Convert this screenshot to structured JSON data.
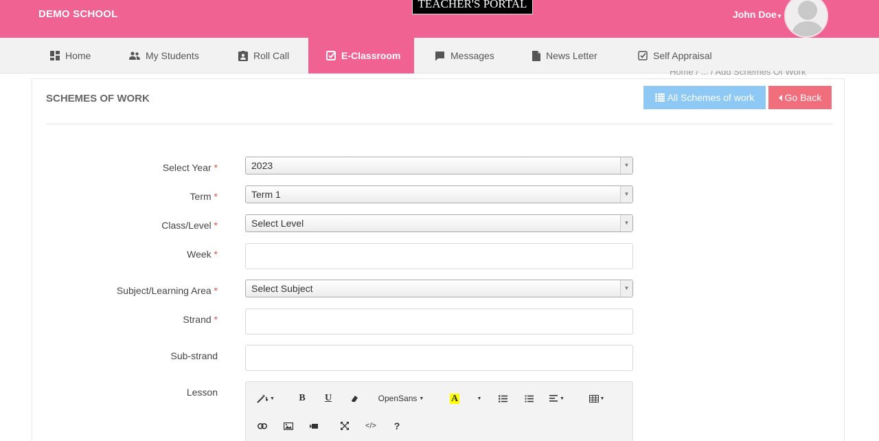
{
  "header": {
    "school_name": "DEMO SCHOOL",
    "portal_title": "TEACHER'S PORTAL",
    "user_name": "John Doe",
    "user_caret": "▾"
  },
  "nav": {
    "items": [
      {
        "label": "Home",
        "icon": "dashboard-icon"
      },
      {
        "label": "My Students",
        "icon": "users-icon"
      },
      {
        "label": "Roll Call",
        "icon": "id-badge-icon"
      },
      {
        "label": "E-Classroom",
        "icon": "check-square-icon",
        "active": true
      },
      {
        "label": "Messages",
        "icon": "comment-icon"
      },
      {
        "label": "News Letter",
        "icon": "file-icon"
      },
      {
        "label": "Self Appraisal",
        "icon": "check-box-icon"
      }
    ]
  },
  "breadcrumb": "Home  /  ...  /  Add Schemes Of Work",
  "panel": {
    "title": "SCHEMES OF WORK",
    "all_schemes_label": "All Schemes of work",
    "go_back_label": "Go Back"
  },
  "form": {
    "year": {
      "label": "Select Year",
      "value": "2023"
    },
    "term": {
      "label": "Term",
      "value": "Term 1"
    },
    "class_level": {
      "label": "Class/Level",
      "value": "Select Level"
    },
    "week": {
      "label": "Week",
      "value": ""
    },
    "subject": {
      "label": "Subject/Learning Area",
      "value": "Select Subject"
    },
    "strand": {
      "label": "Strand",
      "value": ""
    },
    "sub_strand": {
      "label": "Sub-strand",
      "value": ""
    },
    "lesson": {
      "label": "Lesson"
    }
  },
  "editor": {
    "font_name": "OpenSans",
    "help": "?",
    "code": "</>"
  },
  "colors": {
    "brand_pink": "#f06292",
    "info_button": "#8ec9f5",
    "danger_button": "#f16f7c"
  }
}
